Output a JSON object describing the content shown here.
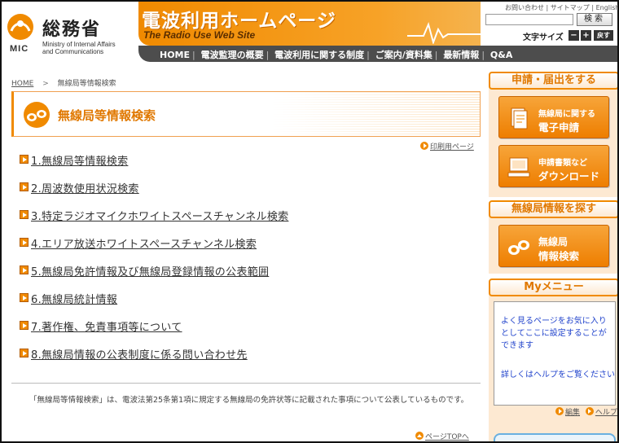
{
  "header": {
    "org_name": "総務省",
    "org_mark": "MIC",
    "org_en_line1": "Ministry of Internal Affairs",
    "org_en_line2": "and Communications",
    "site_title": "電波利用ホームページ",
    "site_subtitle": "The Radio Use Web Site",
    "top_links": [
      "お問い合わせ",
      "サイトマップ",
      "English"
    ],
    "search_button": "検索",
    "search_value": "",
    "font_size_label": "文字サイズ",
    "font_minus": "−",
    "font_plus": "+",
    "font_reset": "戻す",
    "nav": [
      "HOME",
      "電波監理の概要",
      "電波利用に関する制度",
      "ご案内/資料集",
      "最新情報",
      "Q&A"
    ]
  },
  "breadcrumb": {
    "home": "HOME",
    "arrow": ">",
    "current": "無線局等情報検索"
  },
  "page": {
    "title": "無線局等情報検索",
    "print_link": "印刷用ページ",
    "items": [
      "1.無線局等情報検索",
      "2.周波数使用状況検索",
      "3.特定ラジオマイクホワイトスペースチャンネル検索",
      "4.エリア放送ホワイトスペースチャンネル検索",
      "5.無線局免許情報及び無線局登録情報の公表範囲",
      "6.無線局統計情報",
      "7.著作権、免責事項等について",
      "8.無線局情報の公表制度に係る問い合わせ先"
    ],
    "description": "「無線局等情報検索」は、電波法第25条第1項に規定する無線局の免許状等に記載された事項について公表しているものです。",
    "pagetop_link": "ページTOPへ"
  },
  "sidebar": {
    "apply_head": "申請・届出をする",
    "e_apply_small": "無線局に関する",
    "e_apply_big": "電子申請",
    "download_small": "申請書類など",
    "download_big": "ダウンロード",
    "search_head": "無線局情報を探す",
    "search_btn_line1": "無線局",
    "search_btn_line2": "情報検索",
    "mymenu_head": "Myメニュー",
    "mymenu_text": "よく見るページをお気に入りとしてここに設定することができます",
    "mymenu_help": "詳しくはヘルプをご覧ください",
    "edit_link": "編集",
    "help_link": "ヘルプ"
  },
  "colors": {
    "accent": "#f08a00",
    "nav_bg": "#4d4d4d",
    "link_blue": "#2244cc"
  }
}
